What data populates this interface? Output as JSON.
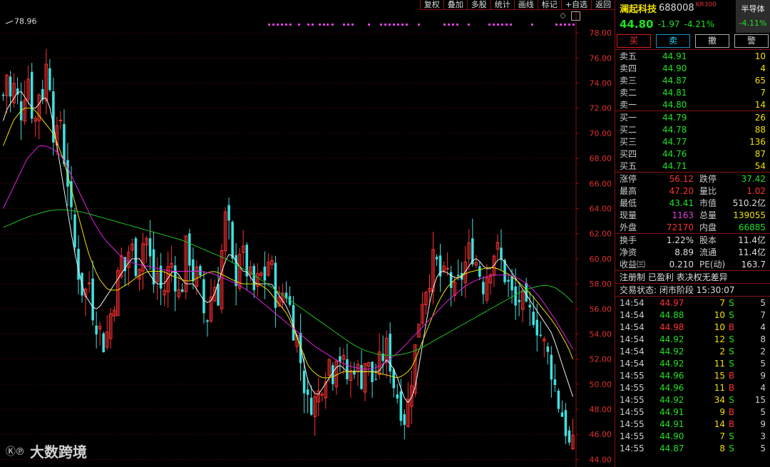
{
  "toolbar": [
    "复权",
    "叠加",
    "多股",
    "统计",
    "画线",
    "标记",
    "+自选",
    "返回"
  ],
  "chart_ctl": {
    "diamond": "◇",
    "square": "▯"
  },
  "watermark": {
    "logo": "Ⓚ℗",
    "text": "大数跨境"
  },
  "stock": {
    "name": "澜起科技",
    "code": "688008",
    "tag": "KR300",
    "price": "44.80",
    "change": "-1.97",
    "pct": "-4.21%"
  },
  "sector": {
    "name": "半导体",
    "pct": "-4.11%"
  },
  "trade_buttons": {
    "buy": "买",
    "sell": "卖",
    "cancel": "撤",
    "alert": "警"
  },
  "order_book": {
    "asks": [
      {
        "label": "卖五",
        "price": "44.91",
        "vol": "10"
      },
      {
        "label": "卖四",
        "price": "44.90",
        "vol": "4"
      },
      {
        "label": "卖三",
        "price": "44.87",
        "vol": "65"
      },
      {
        "label": "卖二",
        "price": "44.81",
        "vol": "7"
      },
      {
        "label": "卖一",
        "price": "44.80",
        "vol": "14"
      }
    ],
    "bids": [
      {
        "label": "买一",
        "price": "44.79",
        "vol": "26"
      },
      {
        "label": "买二",
        "price": "44.78",
        "vol": "88"
      },
      {
        "label": "买三",
        "price": "44.77",
        "vol": "136"
      },
      {
        "label": "买四",
        "price": "44.76",
        "vol": "87"
      },
      {
        "label": "买五",
        "price": "44.71",
        "vol": "54"
      }
    ]
  },
  "stats1": [
    {
      "k": "涨停",
      "v": "56.12",
      "vc": "red",
      "k2": "跌停",
      "v2": "37.42",
      "v2c": "green"
    },
    {
      "k": "最高",
      "v": "47.20",
      "vc": "red",
      "k2": "量比",
      "v2": "1.02",
      "v2c": "red"
    },
    {
      "k": "最低",
      "v": "43.41",
      "vc": "green",
      "k2": "市值",
      "v2": "510.2亿",
      "v2c": "white"
    },
    {
      "k": "现量",
      "v": "1163",
      "vc": "magenta",
      "k2": "总量",
      "v2": "139055",
      "v2c": "yellow"
    },
    {
      "k": "外盘",
      "v": "72170",
      "vc": "red",
      "k2": "内盘",
      "v2": "66885",
      "v2c": "green"
    }
  ],
  "stats2": [
    {
      "k": "换手",
      "v": "1.22%",
      "vc": "white",
      "k2": "股本",
      "v2": "11.4亿",
      "v2c": "white"
    },
    {
      "k": "净资",
      "v": "8.89",
      "vc": "white",
      "k2": "流通",
      "v2": "11.4亿",
      "v2c": "white"
    },
    {
      "k": "收益㈢",
      "v": "0.210",
      "vc": "white",
      "k2": "PE(动)",
      "v2": "163.7",
      "v2c": "white"
    }
  ],
  "info": {
    "reg": "注册制 已盈利 表决权无差异",
    "status": "交易状态: 闭市阶段 15:30:07"
  },
  "ticks": [
    {
      "t": "14:54",
      "p": "44.97",
      "pc": "red",
      "v": "7",
      "f": "S",
      "fc": "green",
      "n": "5"
    },
    {
      "t": "14:54",
      "p": "44.88",
      "pc": "green",
      "v": "10",
      "f": "S",
      "fc": "green",
      "n": "7"
    },
    {
      "t": "14:54",
      "p": "44.98",
      "pc": "red",
      "v": "10",
      "f": "B",
      "fc": "red",
      "n": "4"
    },
    {
      "t": "14:54",
      "p": "44.92",
      "pc": "green",
      "v": "12",
      "f": "S",
      "fc": "green",
      "n": "8"
    },
    {
      "t": "14:54",
      "p": "44.92",
      "pc": "green",
      "v": "2",
      "f": "S",
      "fc": "green",
      "n": "2"
    },
    {
      "t": "14:54",
      "p": "44.92",
      "pc": "green",
      "v": "11",
      "f": "S",
      "fc": "green",
      "n": "5"
    },
    {
      "t": "14:55",
      "p": "44.96",
      "pc": "green",
      "v": "15",
      "f": "B",
      "fc": "red",
      "n": "9"
    },
    {
      "t": "14:55",
      "p": "44.96",
      "pc": "green",
      "v": "11",
      "f": "B",
      "fc": "red",
      "n": "4"
    },
    {
      "t": "14:55",
      "p": "44.92",
      "pc": "green",
      "v": "34",
      "f": "S",
      "fc": "green",
      "n": "15"
    },
    {
      "t": "14:55",
      "p": "44.91",
      "pc": "green",
      "v": "9",
      "f": "B",
      "fc": "red",
      "n": "5"
    },
    {
      "t": "14:55",
      "p": "44.91",
      "pc": "green",
      "v": "14",
      "f": "B",
      "fc": "red",
      "n": "9"
    },
    {
      "t": "14:55",
      "p": "44.90",
      "pc": "green",
      "v": "7",
      "f": "S",
      "fc": "green",
      "n": "3"
    },
    {
      "t": "14:55",
      "p": "44.87",
      "pc": "green",
      "v": "8",
      "f": "S",
      "fc": "green",
      "n": "5"
    }
  ],
  "chart_data": {
    "type": "candlestick",
    "ylim": [
      43.4,
      79.6
    ],
    "y_ticks": [
      44,
      46,
      48,
      50,
      52,
      54,
      56,
      58,
      60,
      62,
      64,
      66,
      68,
      70,
      72,
      74,
      76,
      78
    ],
    "y_tick_labels": [
      "44.00",
      "46.00",
      "48.00",
      "50.00",
      "52.00",
      "54.00",
      "56.00",
      "58.00",
      "60.00",
      "62.00",
      "64.00",
      "66.00",
      "68.00",
      "70.00",
      "72.00",
      "74.00",
      "76.00",
      "78.00"
    ],
    "high_marker": "78.96",
    "n_bars": 160,
    "closes": [
      73,
      75,
      72,
      74.5,
      71,
      73,
      75,
      72,
      71,
      74,
      73,
      77,
      71,
      69,
      71.5,
      68,
      66,
      62,
      60,
      58,
      57,
      58.5,
      56,
      55,
      54,
      53,
      55,
      56.5,
      58,
      60,
      59,
      61,
      60.5,
      59,
      61,
      62,
      60,
      58,
      59,
      57,
      58,
      60,
      59,
      57,
      58,
      61,
      60,
      58,
      59,
      56,
      55,
      57,
      58,
      57,
      62,
      64,
      60,
      58,
      61,
      60,
      59,
      58,
      57,
      59,
      58,
      60,
      59,
      57,
      56,
      58,
      57,
      55,
      54,
      52,
      50,
      48,
      49,
      48.5,
      50,
      51,
      52,
      51,
      53,
      52,
      51,
      50,
      52,
      51,
      50.5,
      52,
      51,
      50,
      51,
      52,
      53,
      52,
      50,
      49,
      48,
      47,
      50,
      52,
      55,
      57,
      58,
      59,
      60,
      59,
      58,
      59,
      58,
      57,
      58,
      59,
      60,
      61,
      60,
      59,
      58,
      59,
      60,
      61,
      60,
      59,
      58,
      57,
      56,
      57,
      56,
      55,
      56,
      55,
      54,
      53,
      52,
      51,
      49,
      48,
      47,
      45,
      44.8
    ],
    "ma5": [
      71,
      72,
      72.5,
      73,
      73.5,
      73,
      72.5,
      72,
      72,
      72.5,
      73,
      72.5,
      71,
      69,
      67,
      65,
      63,
      61,
      59.5,
      58,
      57,
      56.5,
      56,
      56,
      56.5,
      57,
      57.5,
      58,
      58.5,
      59,
      59.5,
      60,
      60,
      60,
      59.5,
      59,
      58.5,
      58,
      58,
      58,
      58.5,
      59,
      59,
      58.5,
      58,
      58,
      58,
      57.5,
      57,
      56.5,
      56.5,
      57,
      58,
      59,
      60,
      60.5,
      60,
      59.5,
      59,
      59,
      58.5,
      58,
      58,
      58,
      58,
      58,
      57.5,
      57,
      56.5,
      56,
      55,
      54,
      53,
      51.5,
      50,
      49.5,
      49,
      49.5,
      50,
      50.5,
      51,
      51.5,
      51.5,
      51,
      51,
      51,
      51,
      51,
      51,
      51,
      51,
      51,
      51.5,
      52,
      51.5,
      51,
      50,
      49,
      48.5,
      49,
      50,
      52,
      54,
      56,
      57.5,
      58.5,
      59,
      59,
      58.8,
      58.5,
      58.5,
      58.5,
      59,
      59.5,
      60,
      60,
      59.5,
      59.2,
      59.2,
      59.5,
      60,
      60,
      59.5,
      59,
      58.5,
      58,
      57.5,
      57,
      56.5,
      56,
      55.5,
      55,
      54.5,
      54,
      53,
      52,
      51,
      50,
      49
    ],
    "ma10": [
      69,
      70,
      71,
      71.5,
      72,
      72,
      72,
      71.5,
      71,
      70.5,
      70,
      69,
      68,
      66.5,
      65,
      63.5,
      62,
      60.5,
      59.5,
      58.5,
      58,
      57.5,
      57.5,
      57.5,
      57.8,
      58,
      58.3,
      58.6,
      58.8,
      59,
      59,
      59,
      59,
      58.8,
      58.6,
      58.5,
      58.3,
      58.2,
      58.3,
      58.5,
      58.7,
      58.9,
      59,
      58.9,
      58.7,
      58.5,
      58.3,
      58.1,
      58,
      58,
      58,
      58,
      57.8,
      57.5,
      57,
      56.5,
      56,
      55.5,
      54.5,
      53.5,
      52.5,
      51.5,
      51,
      50.7,
      50.5,
      50.5,
      50.6,
      50.8,
      51,
      51,
      51,
      51,
      51,
      51,
      51,
      50.9,
      50.8,
      50.7,
      50.6,
      50.5,
      50.7,
      51,
      51.5,
      52.5,
      53.5,
      54.5,
      55.5,
      56.5,
      57.2,
      57.8,
      58.2,
      58.5,
      58.7,
      58.9,
      59,
      59.1,
      59.2,
      59.3,
      59.3,
      59.2,
      59,
      58.8,
      58.5,
      58.2,
      57.8,
      57.4,
      57,
      56.5,
      56,
      55.5,
      55,
      54.4,
      53.7,
      53,
      52
    ],
    "ma20": [
      64,
      65,
      66,
      67,
      68,
      68.5,
      69,
      69,
      68.8,
      68.5,
      68,
      67,
      66,
      65,
      64,
      63,
      62.2,
      61.5,
      61,
      60.5,
      60,
      59.8,
      59.6,
      59.5,
      59.4,
      59.3,
      59.2,
      59.1,
      59,
      59,
      59,
      59,
      59,
      59,
      58.9,
      58.8,
      58.6,
      58.4,
      58.2,
      58,
      57.7,
      57.4,
      57,
      56.6,
      56.2,
      55.8,
      55.4,
      55,
      54.6,
      54.2,
      53.8,
      53.4,
      53,
      52.7,
      52.4,
      52.1,
      51.8,
      51.6,
      51.4,
      51.3,
      51.2,
      51.2,
      51.3,
      51.5,
      51.8,
      52.2,
      52.6,
      53.1,
      53.6,
      54.1,
      54.6,
      55.1,
      55.6,
      56.1,
      56.6,
      57,
      57.4,
      57.8,
      58.1,
      58.3,
      58.5,
      58.6,
      58.7,
      58.7,
      58.7,
      58.6,
      58.4,
      58.1,
      57.7,
      57.2,
      56.6,
      55.9,
      55.2,
      54.4,
      53.6,
      52.8
    ],
    "ma60": [
      62.5,
      62.8,
      63.1,
      63.4,
      63.6,
      63.8,
      63.9,
      63.9,
      63.8,
      63.7,
      63.5,
      63.3,
      63.1,
      62.9,
      62.7,
      62.5,
      62.3,
      62.1,
      61.9,
      61.7,
      61.5,
      61.2,
      60.9,
      60.6,
      60.3,
      60,
      59.6,
      59.2,
      58.8,
      58.3,
      57.8,
      57.3,
      56.8,
      56.3,
      55.8,
      55.3,
      54.8,
      54.3,
      53.8,
      53.3,
      52.9,
      52.6,
      52.4,
      52.3,
      52.3,
      52.4,
      52.6,
      52.9,
      53.3,
      53.7,
      54.1,
      54.5,
      54.9,
      55.3,
      55.7,
      56.1,
      56.5,
      56.9,
      57.3,
      57.6,
      57.8,
      57.9,
      57.7,
      57.2,
      56.5
    ]
  }
}
